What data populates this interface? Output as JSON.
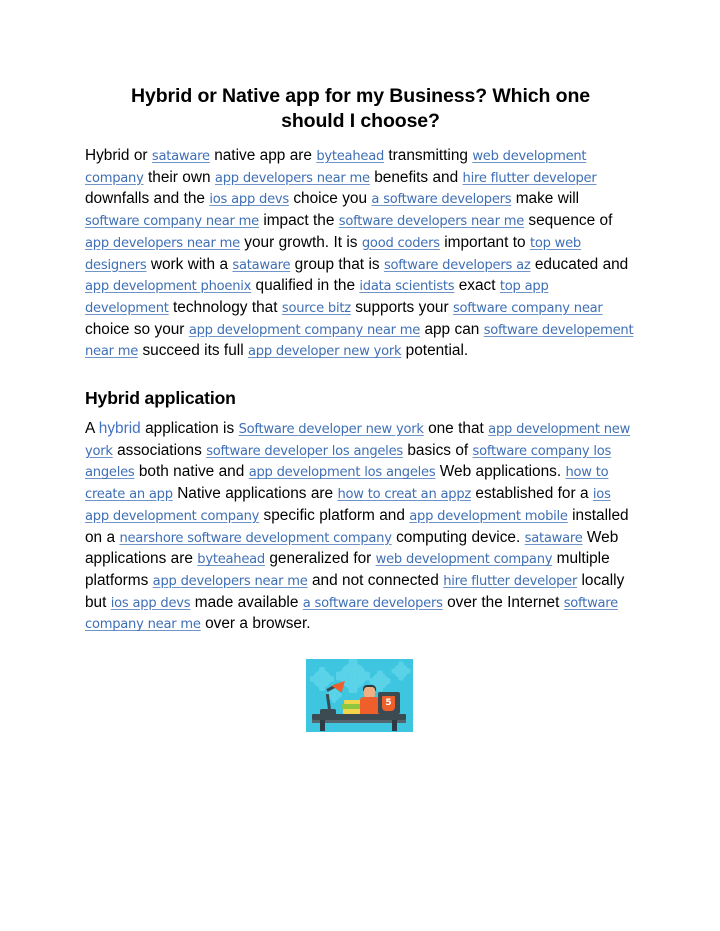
{
  "document": {
    "title": "Hybrid or Native app for my Business? Which one should I choose?",
    "link_color": "#3f6fb5",
    "keyword_color": "#4472c4",
    "text_color": "#000000",
    "background_color": "#ffffff"
  },
  "paragraph_1": {
    "runs": [
      {
        "type": "text",
        "text": "Hybrid or "
      },
      {
        "type": "link",
        "text": "sataware"
      },
      {
        "type": "text",
        "text": " native app are "
      },
      {
        "type": "link",
        "text": "byteahead"
      },
      {
        "type": "text",
        "text": " transmitting "
      },
      {
        "type": "link",
        "text": "web development company"
      },
      {
        "type": "text",
        "text": " their own "
      },
      {
        "type": "link",
        "text": "app developers near me"
      },
      {
        "type": "text",
        "text": " benefits and "
      },
      {
        "type": "link",
        "text": "hire flutter developer"
      },
      {
        "type": "text",
        "text": " downfalls and the "
      },
      {
        "type": "link",
        "text": "ios app devs"
      },
      {
        "type": "text",
        "text": " choice you "
      },
      {
        "type": "link",
        "text": "a software developers"
      },
      {
        "type": "text",
        "text": " make will "
      },
      {
        "type": "link",
        "text": "software company near me"
      },
      {
        "type": "text",
        "text": " impact the "
      },
      {
        "type": "link",
        "text": "software developers near me"
      },
      {
        "type": "text",
        "text": " sequence of "
      },
      {
        "type": "link",
        "text": "app developers near me"
      },
      {
        "type": "text",
        "text": " your growth. It is "
      },
      {
        "type": "link",
        "text": "good coders"
      },
      {
        "type": "text",
        "text": " important to "
      },
      {
        "type": "link",
        "text": "top web designers"
      },
      {
        "type": "text",
        "text": " work with a "
      },
      {
        "type": "link",
        "text": "sataware"
      },
      {
        "type": "text",
        "text": " group that is "
      },
      {
        "type": "link",
        "text": "software developers az"
      },
      {
        "type": "text",
        "text": " educated and  "
      },
      {
        "type": "link",
        "text": "app development phoenix"
      },
      {
        "type": "text",
        "text": " qualified in the "
      },
      {
        "type": "link",
        "text": "idata scientists"
      },
      {
        "type": "text",
        "text": " exact "
      },
      {
        "type": "link",
        "text": "top app development"
      },
      {
        "type": "text",
        "text": " technology that "
      },
      {
        "type": "link",
        "text": "source bitz"
      },
      {
        "type": "text",
        "text": " supports your "
      },
      {
        "type": "link",
        "text": "software company near"
      },
      {
        "type": "text",
        "text": " choice so your "
      },
      {
        "type": "link",
        "text": "app development company near me"
      },
      {
        "type": "text",
        "text": " app can "
      },
      {
        "type": "link",
        "text": "software developement near me"
      },
      {
        "type": "text",
        "text": " succeed its full "
      },
      {
        "type": "link",
        "text": "app developer new york"
      },
      {
        "type": "text",
        "text": " potential."
      }
    ]
  },
  "section_heading": "Hybrid application",
  "paragraph_2": {
    "runs": [
      {
        "type": "text",
        "text": "A "
      },
      {
        "type": "keyword",
        "text": "hybrid"
      },
      {
        "type": "text",
        "text": " application is "
      },
      {
        "type": "link",
        "text": "Software developer new york"
      },
      {
        "type": "text",
        "text": " one that "
      },
      {
        "type": "link",
        "text": "app development new york"
      },
      {
        "type": "text",
        "text": " associations "
      },
      {
        "type": "link",
        "text": "software developer los angeles"
      },
      {
        "type": "text",
        "text": " basics of "
      },
      {
        "type": "link",
        "text": "software company los angeles"
      },
      {
        "type": "text",
        "text": " both native and "
      },
      {
        "type": "link",
        "text": "app development los angeles"
      },
      {
        "type": "text",
        "text": " Web applications. "
      },
      {
        "type": "link",
        "text": "how to create an app"
      },
      {
        "type": "text",
        "text": " Native applications are "
      },
      {
        "type": "link",
        "text": "how to creat an appz"
      },
      {
        "type": "text",
        "text": " established for a "
      },
      {
        "type": "link",
        "text": "ios app development company"
      },
      {
        "type": "text",
        "text": " specific platform and "
      },
      {
        "type": "link",
        "text": "app development mobile"
      },
      {
        "type": "text",
        "text": " installed on a "
      },
      {
        "type": "link",
        "text": "nearshore software development company"
      },
      {
        "type": "text",
        "text": " computing device. "
      },
      {
        "type": "link",
        "text": "sataware"
      },
      {
        "type": "text",
        "text": " Web applications are "
      },
      {
        "type": "link",
        "text": "byteahead"
      },
      {
        "type": "text",
        "text": " generalized for "
      },
      {
        "type": "link",
        "text": "web development company"
      },
      {
        "type": "text",
        "text": " multiple platforms "
      },
      {
        "type": "link",
        "text": "app developers near me"
      },
      {
        "type": "text",
        "text": " and not connected "
      },
      {
        "type": "link",
        "text": "hire flutter developer"
      },
      {
        "type": "text",
        "text": " locally but "
      },
      {
        "type": "link",
        "text": "ios app devs"
      },
      {
        "type": "text",
        "text": " made available "
      },
      {
        "type": "link",
        "text": "a software developers"
      },
      {
        "type": "text",
        "text": " over the Internet "
      },
      {
        "type": "link",
        "text": "software company near me"
      },
      {
        "type": "text",
        "text": " over a browser."
      }
    ]
  },
  "figure": {
    "alt": "Flat illustration of a developer working at a desk with a laptop showing an HTML5 badge, a desk lamp and stacked books on a turquoise background with gear shapes",
    "html5_badge_label": "5",
    "colors": {
      "background": "#3ec6e0",
      "gear": "#5ad2e8",
      "desk": "#3c4a52",
      "accent": "#ef5f2b",
      "book_yellow": "#f2d54a",
      "book_green": "#8dc63f"
    }
  }
}
